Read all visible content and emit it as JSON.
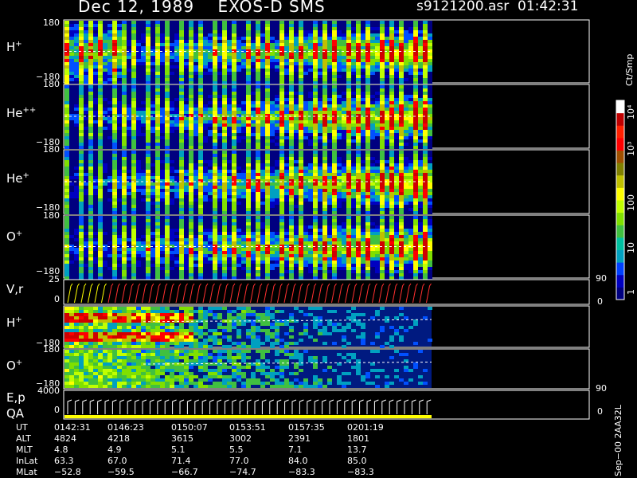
{
  "header": {
    "title_left": "Dec 12, 1989    EXOS-D SMS",
    "title_right": "s9121200.asr  01:42:31"
  },
  "colorbar": {
    "unit_label": "Ct/Smp",
    "tick_labels": [
      "1",
      "10",
      "100",
      "10³",
      "10⁴"
    ],
    "colors": [
      "#000080",
      "#0000c0",
      "#0040ff",
      "#00a0c0",
      "#00c0a0",
      "#40c040",
      "#80e000",
      "#c0ff00",
      "#ffff00",
      "#c0c000",
      "#808000",
      "#a05000",
      "#ff0000",
      "#ff2000",
      "#c00000",
      "#ffffff"
    ]
  },
  "side_label": "Sep−00 2AA32L",
  "chart_data": [
    {
      "type": "heatmap",
      "panel": "H+",
      "label_base": "H",
      "label_sup": "+",
      "ylim": [
        -180,
        180
      ],
      "yticks": [
        "180",
        "−180"
      ]
    },
    {
      "type": "heatmap",
      "panel": "He++",
      "label_base": "He",
      "label_sup": "++",
      "ylim": [
        -180,
        180
      ],
      "yticks": [
        "180",
        "−180"
      ]
    },
    {
      "type": "heatmap",
      "panel": "He+",
      "label_base": "He",
      "label_sup": "+",
      "ylim": [
        -180,
        180
      ],
      "yticks": [
        "180",
        "−180"
      ]
    },
    {
      "type": "heatmap",
      "panel": "O+",
      "label_base": "O",
      "label_sup": "+",
      "ylim": [
        -180,
        180
      ],
      "yticks": [
        "180",
        "−180"
      ],
      "right_tick": "90"
    },
    {
      "type": "line",
      "panel": "V,r",
      "label_base": "V,r",
      "label_sup": "",
      "ylim": [
        0,
        25
      ],
      "yticks": [
        "25",
        "0"
      ],
      "right_tick": "0"
    },
    {
      "type": "heatmap",
      "panel": "H+ (lower)",
      "label_base": "H",
      "label_sup": "+",
      "ylim": [
        -180,
        180
      ],
      "yticks": [
        "",
        "−180"
      ]
    },
    {
      "type": "heatmap",
      "panel": "O+ (lower)",
      "label_base": "O",
      "label_sup": "+",
      "ylim": [
        -180,
        180
      ],
      "yticks": [
        "180",
        "−180"
      ],
      "right_tick": "90"
    },
    {
      "type": "line",
      "panel": "E,p QA",
      "label_base": "E,p",
      "label_sub": "QA",
      "label_sup": "",
      "ylim": [
        0,
        4000
      ],
      "yticks": [
        "4000",
        "0"
      ],
      "right_tick": "0"
    }
  ],
  "footer": {
    "rows": [
      {
        "name": "UT",
        "values": [
          "0142:31",
          "0146:23",
          "0150:07",
          "0153:51",
          "0157:35",
          "0201:19"
        ]
      },
      {
        "name": "ALT",
        "values": [
          "4824",
          "4218",
          "3615",
          "3002",
          "2391",
          "1801"
        ]
      },
      {
        "name": "MLT",
        "values": [
          "4.8",
          "4.9",
          "5.1",
          "5.5",
          "7.1",
          "13.7"
        ]
      },
      {
        "name": "InLat",
        "values": [
          "63.3",
          "67.0",
          "71.4",
          "77.0",
          "84.0",
          "85.0"
        ]
      },
      {
        "name": "MLat",
        "values": [
          "−52.8",
          "−59.5",
          "−66.7",
          "−74.7",
          "−83.3",
          "−83.3"
        ]
      }
    ]
  }
}
